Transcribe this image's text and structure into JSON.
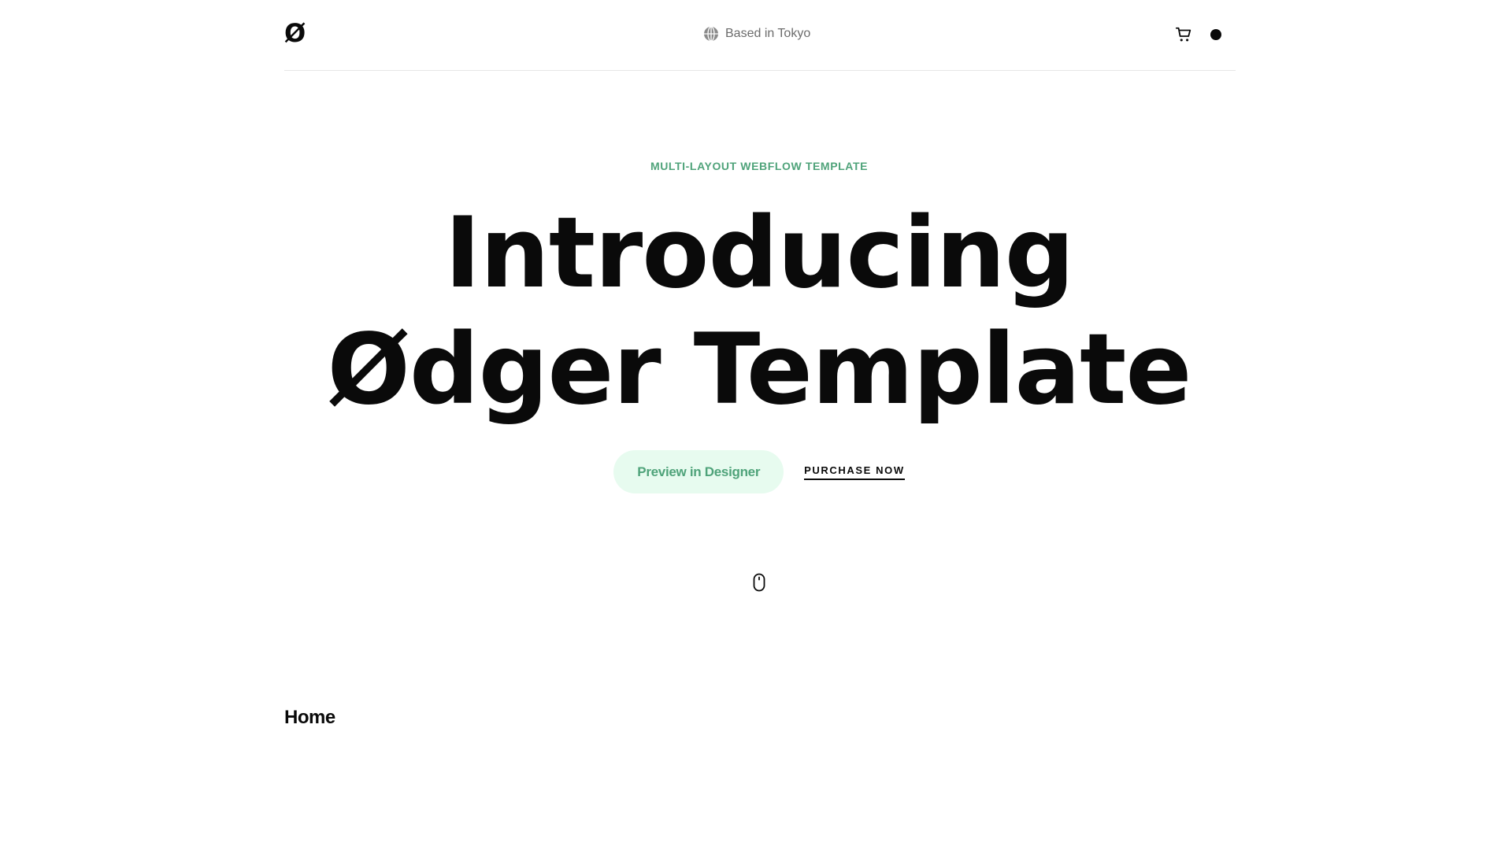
{
  "header": {
    "logo": "Ø",
    "location": "Based in Tokyo",
    "location_icon": "globe-icon",
    "cart_icon": "cart-icon",
    "menu_icon": "dot-icon"
  },
  "hero": {
    "eyebrow": "MULTI-LAYOUT WEBFLOW TEMPLATE",
    "headline_line1": "Introducing",
    "headline_line2": "Ødger Template",
    "preview_button": "Preview in Designer",
    "purchase_link": "PURCHASE NOW",
    "scroll_icon": "mouse-scroll-icon"
  },
  "section": {
    "title": "Home"
  },
  "colors": {
    "accent": "#4fa37a",
    "accent_bg": "#e7fbef",
    "text": "#0a0a0a",
    "muted": "#6b6b6b",
    "divider": "#e6e6e6"
  }
}
